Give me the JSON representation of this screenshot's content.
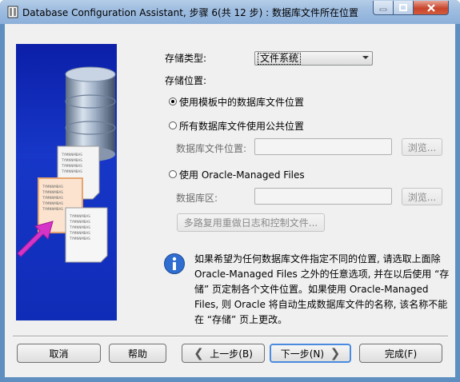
{
  "window": {
    "title": "Database Configuration Assistant, 步骤 6(共 12 步) : 数据库文件所在位置"
  },
  "storage_type": {
    "label": "存储类型:",
    "selected": "文件系统"
  },
  "storage_location": {
    "label": "存储位置:",
    "option_template": "使用模板中的数据库文件位置",
    "option_common": "所有数据库文件使用公共位置",
    "db_file_location_label": "数据库文件位置:",
    "db_file_location_value": "",
    "browse1": "浏览...",
    "option_omf": "使用 Oracle-Managed Files",
    "db_area_label": "数据库区:",
    "db_area_value": "",
    "browse2": "浏览...",
    "multiplex_button": "多路复用重做日志和控制文件..."
  },
  "info": {
    "lines": [
      "如果希望为任何数据库文件指定不同的位置, 请选取上面除",
      "Oracle-Managed Files 之外的任意选项, 并在以后使用 “存",
      "储” 页定制各个文件位置。如果使用 Oracle-Managed",
      "Files, 则 Oracle 将自动生成数据库文件的名称, 该名称不能",
      "在 “存储” 页上更改。"
    ]
  },
  "buttons": {
    "cancel": "取消",
    "help": "帮助",
    "back": "上一步(B)",
    "next": "下一步(N)",
    "finish": "完成(F)"
  },
  "art_doc_text": "TYMNNMBAS"
}
